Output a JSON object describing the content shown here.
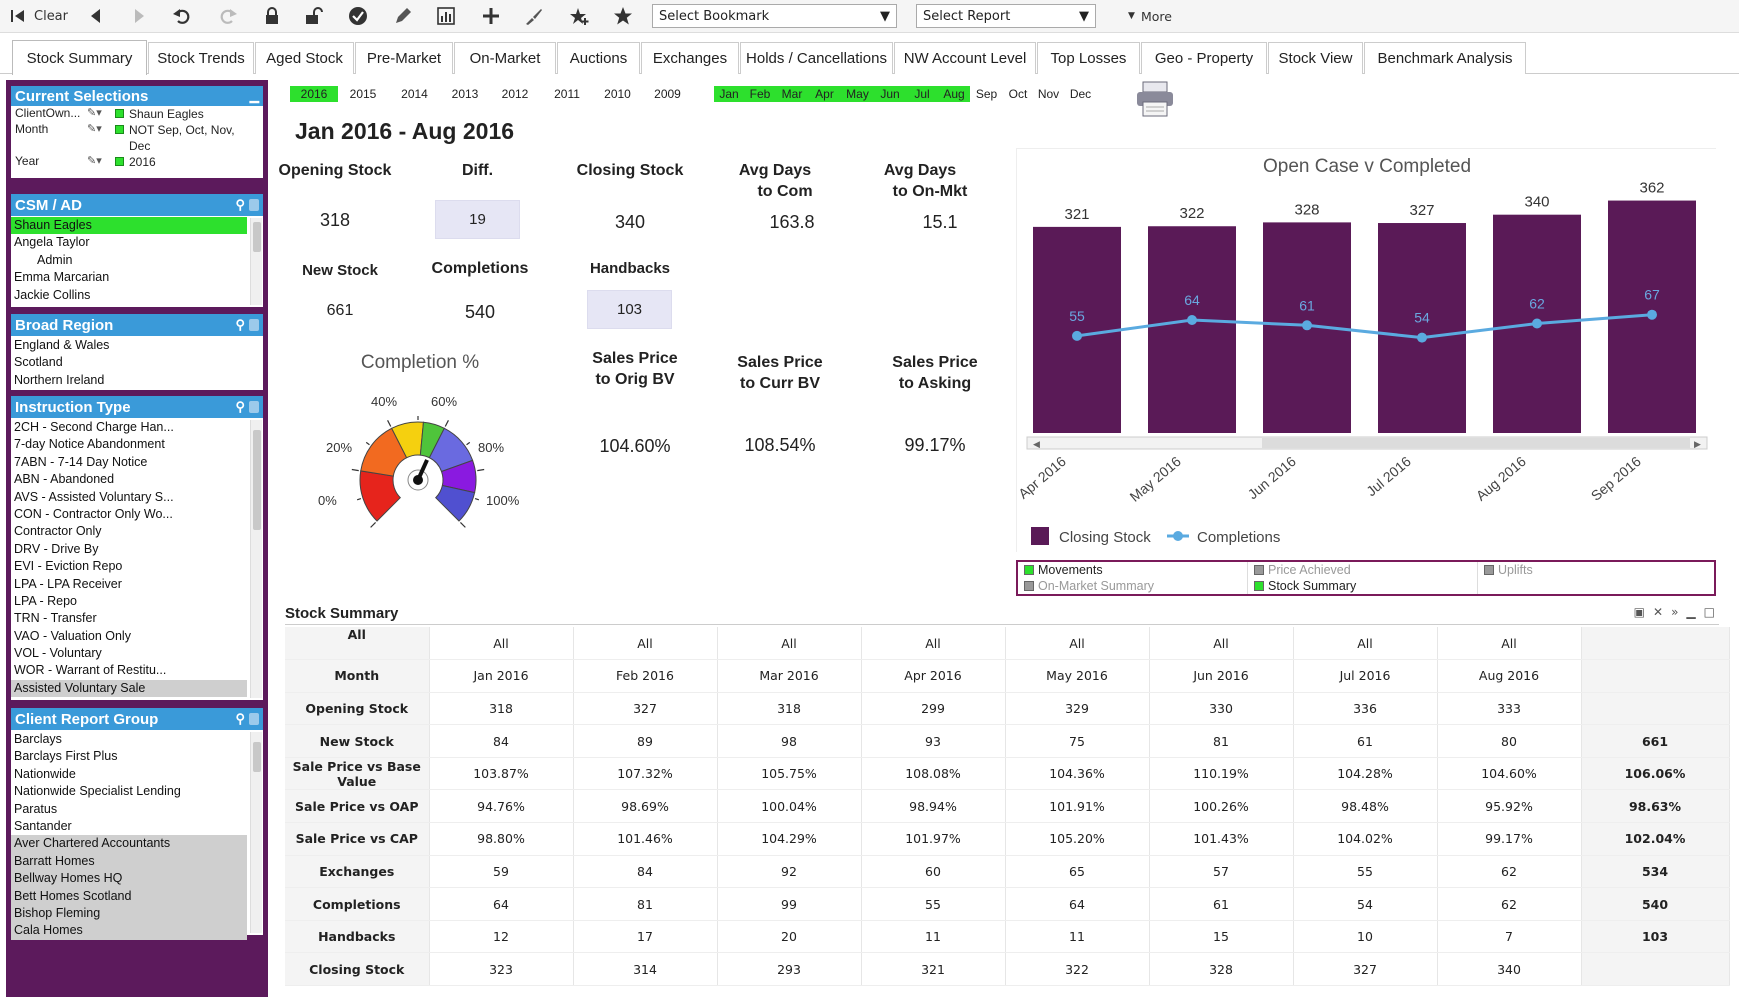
{
  "toolbar": {
    "clear": "Clear",
    "bookmark": "Select Bookmark",
    "report": "Select Report",
    "more": "More"
  },
  "tabs": [
    "Stock Summary",
    "Stock Trends",
    "Aged Stock",
    "Pre-Market",
    "On-Market",
    "Auctions",
    "Exchanges",
    "Holds / Cancellations",
    "NW Account Level",
    "Top Losses",
    "Geo - Property",
    "Stock View",
    "Benchmark Analysis"
  ],
  "current": {
    "title": "Current Selections",
    "rows": [
      {
        "f": "ClientOwn...",
        "v": "Shaun Eagles"
      },
      {
        "f": "Month",
        "v": "NOT Sep, Oct, Nov, Dec"
      },
      {
        "f": "Year",
        "v": "2016"
      }
    ]
  },
  "csm": {
    "title": "CSM / AD",
    "items": [
      "Shaun Eagles",
      "Angela Taylor",
      "Admin",
      "Emma Marcarian",
      "Jackie Collins"
    ]
  },
  "region": {
    "title": "Broad Region",
    "items": [
      "England & Wales",
      "Scotland",
      "Northern Ireland"
    ]
  },
  "instr": {
    "title": "Instruction Type",
    "items": [
      "2CH - Second Charge Han...",
      "7-day Notice Abandonment",
      "7ABN - 7-14 Day Notice",
      "ABN - Abandoned",
      "AVS - Assisted Voluntary S...",
      "CON - Contractor Only Wo...",
      "Contractor Only",
      "DRV - Drive By",
      "EVI - Eviction Repo",
      "LPA - LPA Receiver",
      "LPA - Repo",
      "TRN - Transfer",
      "VAO - Valuation Only",
      "VOL - Voluntary",
      "WOR - Warrant of Restitu...",
      "Assisted Voluntary Sale"
    ]
  },
  "crg": {
    "title": "Client Report Group",
    "items": [
      "Barclays",
      "Barclays First Plus",
      "Nationwide",
      "Nationwide Specialist Lending",
      "Paratus",
      "Santander",
      "Aver Chartered Accountants",
      "Barratt Homes",
      "Bellway Homes HQ",
      "Bett Homes Scotland",
      "Bishop Fleming",
      "Cala Homes"
    ]
  },
  "years": [
    "2016",
    "2015",
    "2014",
    "2013",
    "2012",
    "2011",
    "2010",
    "2009"
  ],
  "months": [
    "Jan",
    "Feb",
    "Mar",
    "Apr",
    "May",
    "Jun",
    "Jul",
    "Aug",
    "Sep",
    "Oct",
    "Nov",
    "Dec"
  ],
  "period": "Jan 2016 - Aug 2016",
  "kpi": {
    "opening_l": "Opening Stock",
    "opening_v": "318",
    "diff_l": "Diff.",
    "diff_v": "19",
    "closing_l": "Closing Stock",
    "closing_v": "340",
    "avgcom_l1": "Avg Days",
    "avgcom_l2": "to Com",
    "avgcom_v": "163.8",
    "avgmkt_l1": "Avg Days",
    "avgmkt_l2": "to On-Mkt",
    "avgmkt_v": "15.1",
    "new_l": "New Stock",
    "new_v": "661",
    "comp_l": "Completions",
    "comp_v": "540",
    "hand_l": "Handbacks",
    "hand_v": "103",
    "spob_l1": "Sales Price",
    "spob_l2": "to Orig BV",
    "spob_v": "104.60%",
    "spcb_l1": "Sales Price",
    "spcb_l2": "to Curr BV",
    "spcb_v": "108.54%",
    "spa_l1": "Sales Price",
    "spa_l2": "to Asking",
    "spa_v": "99.17%"
  },
  "gauge": {
    "title": "Completion %",
    "labels": [
      "0%",
      "20%",
      "40%",
      "60%",
      "80%",
      "100%"
    ],
    "value": 0.59
  },
  "chart_data": {
    "type": "bar",
    "title": "Open Case v Completed",
    "categories": [
      "Apr 2016",
      "May 2016",
      "Jun 2016",
      "Jul 2016",
      "Aug 2016",
      "Sep 2016"
    ],
    "series": [
      {
        "name": "Closing Stock",
        "type": "bar",
        "values": [
          321,
          322,
          328,
          327,
          340,
          362
        ]
      },
      {
        "name": "Completions",
        "type": "line",
        "values": [
          55,
          64,
          61,
          54,
          62,
          67
        ]
      }
    ],
    "ylim": [
      0,
      380
    ]
  },
  "minitabs": [
    "Movements",
    "Price Achieved",
    "Uplifts",
    "On-Market Summary",
    "Stock Summary"
  ],
  "table": {
    "title": "Stock Summary",
    "all": "All",
    "cols": [
      "Jan 2016",
      "Feb 2016",
      "Mar 2016",
      "Apr 2016",
      "May 2016",
      "Jun 2016",
      "Jul 2016",
      "Aug 2016"
    ],
    "month_label": "Month",
    "rows": [
      {
        "label": "Opening Stock",
        "vals": [
          "318",
          "327",
          "318",
          "299",
          "329",
          "330",
          "336",
          "333"
        ],
        "total": ""
      },
      {
        "label": "New Stock",
        "vals": [
          "84",
          "89",
          "98",
          "93",
          "75",
          "81",
          "61",
          "80"
        ],
        "total": "661"
      },
      {
        "label": "Sale Price vs Base Value",
        "vals": [
          "103.87%",
          "107.32%",
          "105.75%",
          "108.08%",
          "104.36%",
          "110.19%",
          "104.28%",
          "104.60%"
        ],
        "total": "106.06%"
      },
      {
        "label": "Sale Price vs OAP",
        "vals": [
          "94.76%",
          "98.69%",
          "100.04%",
          "98.94%",
          "101.91%",
          "100.26%",
          "98.48%",
          "95.92%"
        ],
        "total": "98.63%"
      },
      {
        "label": "Sale Price vs CAP",
        "vals": [
          "98.80%",
          "101.46%",
          "104.29%",
          "101.97%",
          "105.20%",
          "101.43%",
          "104.02%",
          "99.17%"
        ],
        "total": "102.04%"
      },
      {
        "label": "Exchanges",
        "vals": [
          "59",
          "84",
          "92",
          "60",
          "65",
          "57",
          "55",
          "62"
        ],
        "total": "534"
      },
      {
        "label": "Completions",
        "vals": [
          "64",
          "81",
          "99",
          "55",
          "64",
          "61",
          "54",
          "62"
        ],
        "total": "540"
      },
      {
        "label": "Handbacks",
        "vals": [
          "12",
          "17",
          "20",
          "11",
          "11",
          "15",
          "10",
          "7"
        ],
        "total": "103"
      },
      {
        "label": "Closing Stock",
        "vals": [
          "323",
          "314",
          "293",
          "321",
          "322",
          "328",
          "327",
          "340"
        ],
        "total": ""
      }
    ]
  },
  "colors": {
    "bar": "#5a1a57",
    "line": "#5aaae0",
    "select": "#2de02d",
    "header": "#3a9ad9",
    "panel": "#5c1a5c"
  }
}
